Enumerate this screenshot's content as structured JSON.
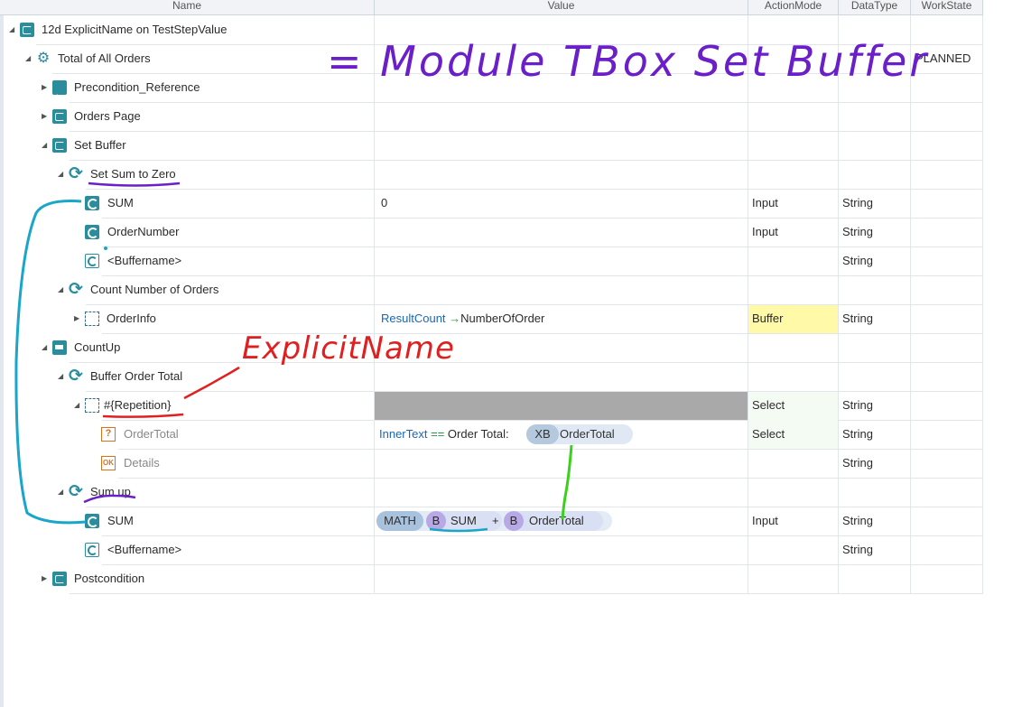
{
  "columns": {
    "name": "Name",
    "value": "Value",
    "action_mode": "ActionMode",
    "data_type": "DataType",
    "work_state": "WorkState"
  },
  "rows": [
    {
      "name": "12d ExplicitName on TestStepValue",
      "value": "",
      "action_mode": "",
      "data_type": "",
      "work_state": "",
      "icon": "folder-icon"
    },
    {
      "name": "Total of All Orders",
      "value": "",
      "action_mode": "",
      "data_type": "",
      "work_state": "PLANNED",
      "icon": "wrench-icon"
    },
    {
      "name": "Precondition_Reference",
      "value": "",
      "action_mode": "",
      "data_type": "",
      "work_state": "",
      "icon": "reference-icon"
    },
    {
      "name": "Orders Page",
      "value": "",
      "action_mode": "",
      "data_type": "",
      "work_state": "",
      "icon": "folder-icon"
    },
    {
      "name": "Set  Buffer",
      "value": "",
      "action_mode": "",
      "data_type": "",
      "work_state": "",
      "icon": "folder-icon"
    },
    {
      "name": "Set Sum to Zero",
      "value": "",
      "action_mode": "",
      "data_type": "",
      "work_state": "",
      "icon": "sync-icon"
    },
    {
      "name": "SUM",
      "value": "0",
      "action_mode": "Input",
      "data_type": "String",
      "work_state": "",
      "icon": "module-attr-icon"
    },
    {
      "name": "OrderNumber",
      "value": "",
      "action_mode": "Input",
      "data_type": "String",
      "work_state": "",
      "icon": "module-attr-icon"
    },
    {
      "name": "<Buffername>",
      "value": "",
      "action_mode": "",
      "data_type": "String",
      "work_state": "",
      "icon": "module-attr-outline-icon"
    },
    {
      "name": "Count Number of Orders",
      "value": "",
      "action_mode": "",
      "data_type": "",
      "work_state": "",
      "icon": "sync-icon"
    },
    {
      "name": "OrderInfo",
      "value_parts": [
        "ResultCount",
        "→",
        "NumberOfOrder"
      ],
      "action_mode": "Buffer",
      "data_type": "String",
      "work_state": "",
      "icon": "dashed-box-icon"
    },
    {
      "name": "CountUp",
      "value": "",
      "action_mode": "",
      "data_type": "",
      "work_state": "",
      "icon": "folder-loop-icon"
    },
    {
      "name": "Buffer Order Total",
      "value": "",
      "action_mode": "",
      "data_type": "",
      "work_state": "",
      "icon": "sync-icon"
    },
    {
      "name": "#{Repetition}",
      "value": "",
      "action_mode": "Select",
      "data_type": "String",
      "work_state": "",
      "icon": "dashed-box-icon"
    },
    {
      "name": "OrderTotal",
      "value_parts": [
        "InnerText",
        "==",
        "Order Total:",
        "XB",
        "OrderTotal"
      ],
      "action_mode": "Select",
      "data_type": "String",
      "work_state": "",
      "icon": "question-icon"
    },
    {
      "name": "Details",
      "value": "",
      "action_mode": "",
      "data_type": "String",
      "work_state": "",
      "icon": "ok-icon"
    },
    {
      "name": "Sum up",
      "value": "",
      "action_mode": "",
      "data_type": "",
      "work_state": "",
      "icon": "sync-icon"
    },
    {
      "name": "SUM",
      "value_parts": [
        "MATH",
        "B",
        "SUM",
        "+",
        "B",
        "OrderTotal"
      ],
      "action_mode": "Input",
      "data_type": "String",
      "work_state": "",
      "icon": "module-attr-icon"
    },
    {
      "name": "<Buffername>",
      "value": "",
      "action_mode": "",
      "data_type": "String",
      "work_state": "",
      "icon": "module-attr-outline-icon"
    },
    {
      "name": "Postcondition",
      "value": "",
      "action_mode": "",
      "data_type": "",
      "work_state": "",
      "icon": "folder-icon"
    }
  ],
  "annotations": {
    "module_note": "= Module TBox Set Buffer",
    "explicit_name": "ExplicitName"
  },
  "colors": {
    "accent": "#2a8d9c",
    "buffer_highlight": "#fff9a8",
    "select_highlight": "#f3fbf3",
    "disabled_cell": "#a9a9a9",
    "annotation_purple": "#6a1fc9",
    "annotation_red": "#e02020",
    "annotation_cyan": "#19a6c8",
    "annotation_green": "#3bd11a"
  }
}
